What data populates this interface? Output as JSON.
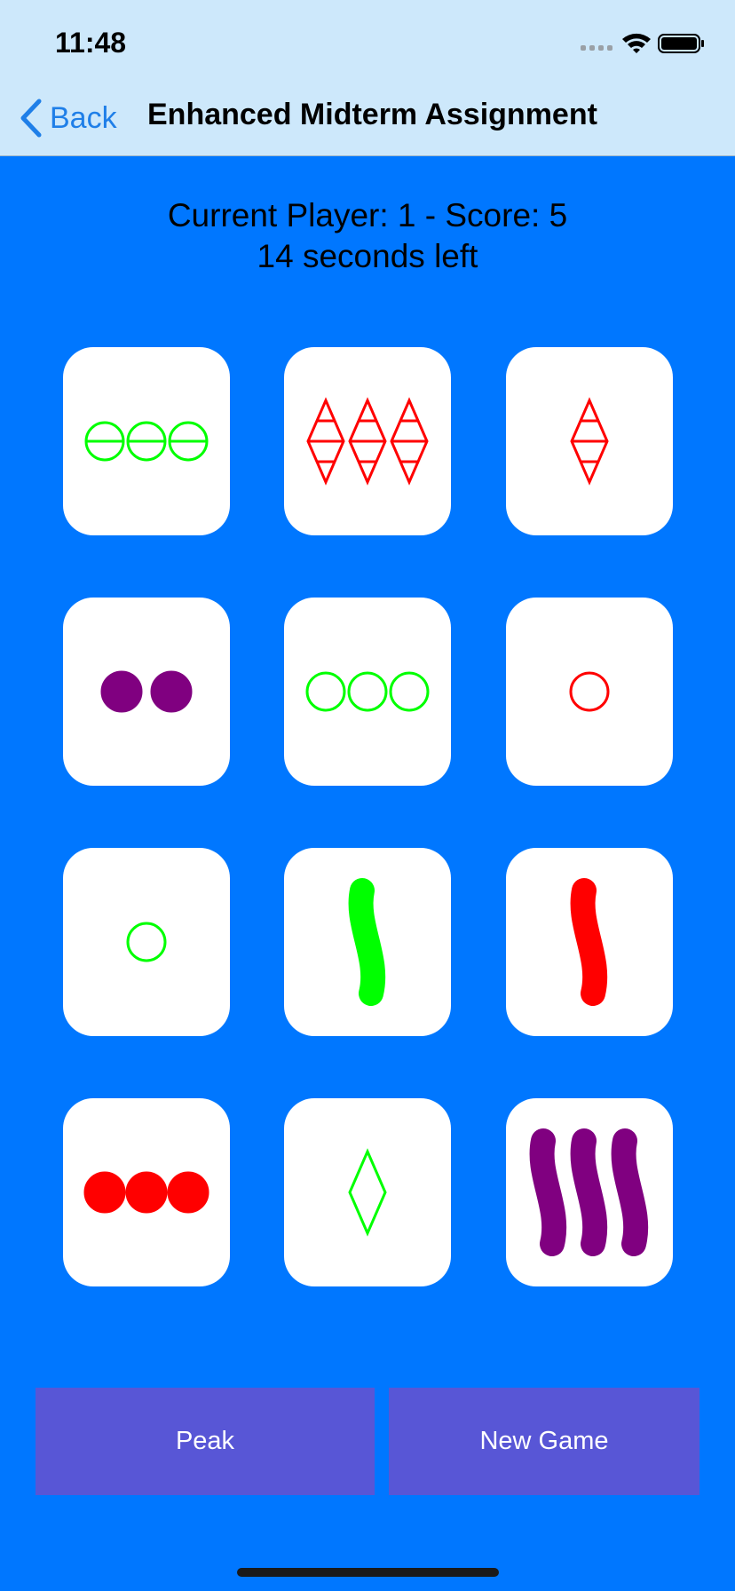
{
  "status_bar": {
    "time": "11:48"
  },
  "nav": {
    "back_label": "Back",
    "title": "Enhanced Midterm Assignment"
  },
  "game": {
    "player_line": "Current Player: 1 - Score: 5",
    "timer_line": "14 seconds left"
  },
  "colors": {
    "background": "#0077ff",
    "button": "#5856d6",
    "green": "#00ff00",
    "red": "#ff0000",
    "purple": "#800080"
  },
  "cards": [
    {
      "count": 3,
      "shape": "oval",
      "fill": "striped",
      "color": "green"
    },
    {
      "count": 3,
      "shape": "diamond",
      "fill": "striped",
      "color": "red"
    },
    {
      "count": 1,
      "shape": "diamond",
      "fill": "striped",
      "color": "red"
    },
    {
      "count": 2,
      "shape": "oval",
      "fill": "solid",
      "color": "purple"
    },
    {
      "count": 3,
      "shape": "oval",
      "fill": "open",
      "color": "green"
    },
    {
      "count": 1,
      "shape": "oval",
      "fill": "open",
      "color": "red"
    },
    {
      "count": 1,
      "shape": "oval",
      "fill": "open",
      "color": "green"
    },
    {
      "count": 1,
      "shape": "squiggle",
      "fill": "solid",
      "color": "green"
    },
    {
      "count": 1,
      "shape": "squiggle",
      "fill": "solid",
      "color": "red"
    },
    {
      "count": 3,
      "shape": "oval",
      "fill": "solid",
      "color": "red"
    },
    {
      "count": 1,
      "shape": "diamond",
      "fill": "open",
      "color": "green"
    },
    {
      "count": 3,
      "shape": "squiggle",
      "fill": "solid",
      "color": "purple"
    }
  ],
  "buttons": {
    "peak_label": "Peak",
    "new_game_label": "New Game"
  }
}
